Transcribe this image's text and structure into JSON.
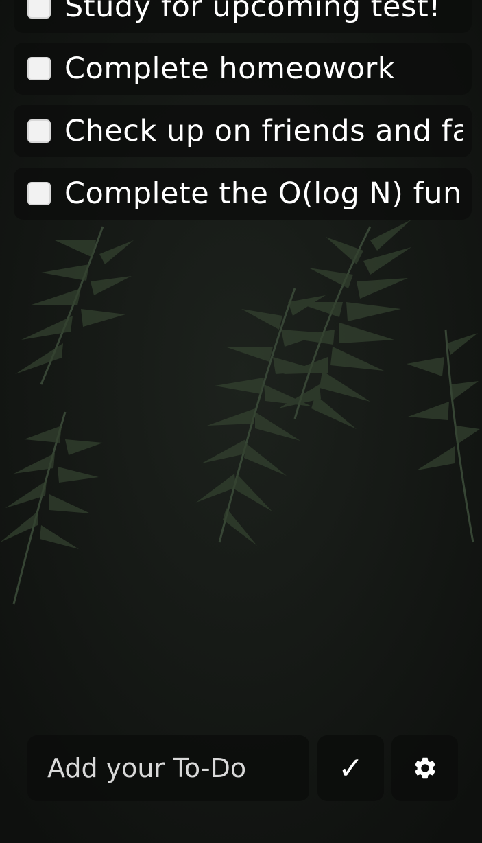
{
  "todos": [
    {
      "text": "Study for upcoming test!",
      "checked": false
    },
    {
      "text": "Complete homeowork",
      "checked": false
    },
    {
      "text": "Check up on friends and fa",
      "checked": false
    },
    {
      "text": "Complete the O(log N) funct",
      "checked": false
    }
  ],
  "add_bar": {
    "placeholder": "Add your To-Do",
    "submit_label": "✓",
    "settings_icon": "gear-icon"
  },
  "colors": {
    "background": "#141614",
    "card": "#0c0d0c",
    "text": "#ffffff",
    "checkbox": "#f2f2f2"
  }
}
